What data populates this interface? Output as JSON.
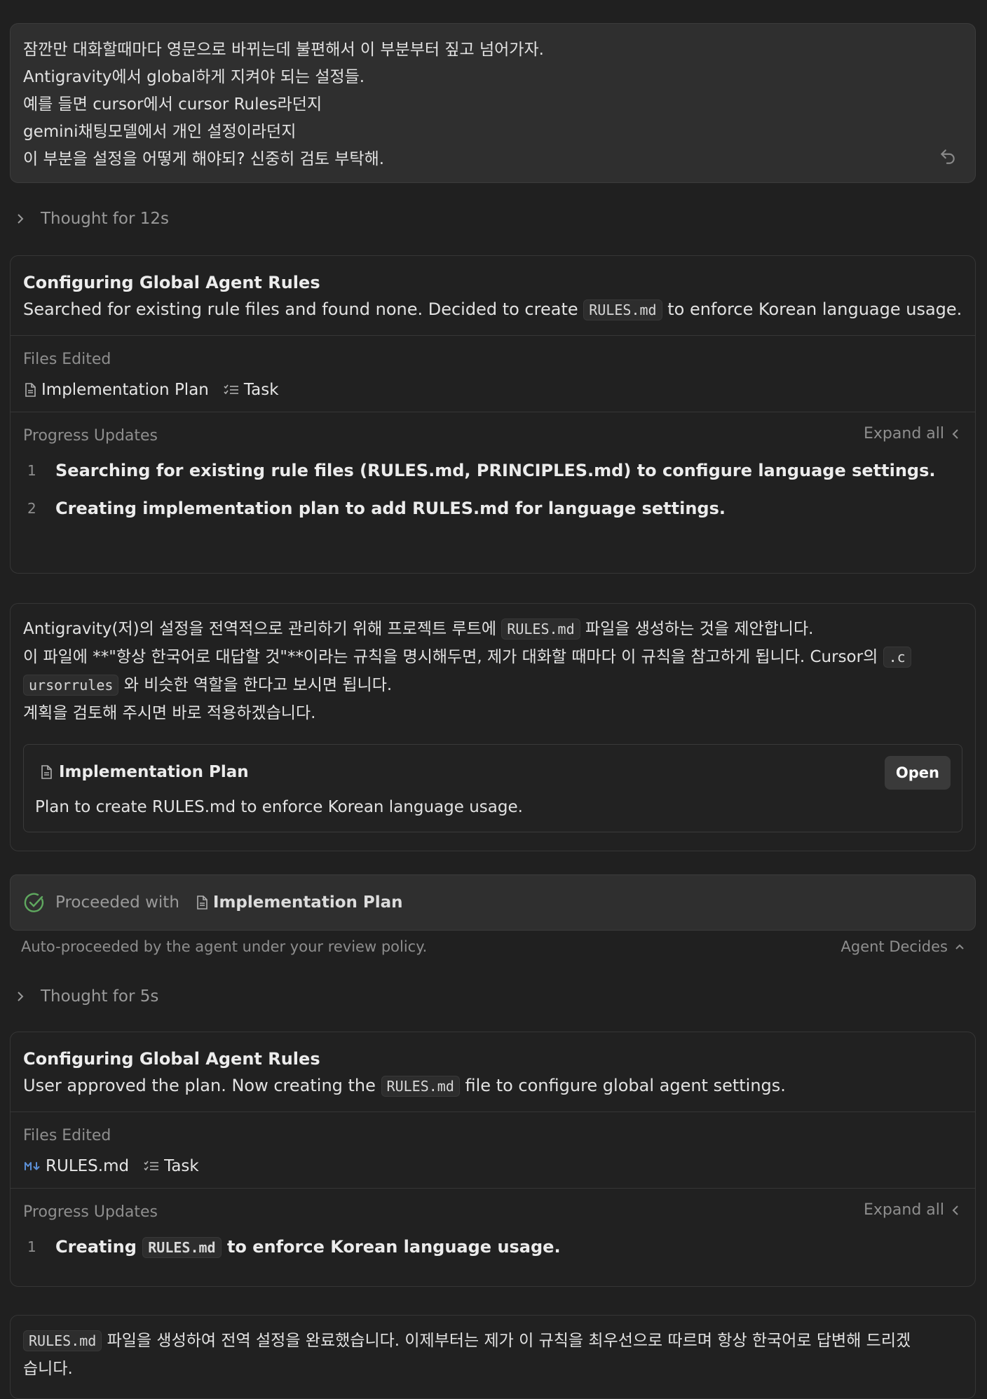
{
  "user_message": {
    "lines": [
      "잠깐만 대화할때마다 영문으로 바뀌는데 불편해서 이 부분부터 짚고 넘어가자.",
      "Antigravity에서 global하게 지켜야 되는 설정들.",
      "예를 들면 cursor에서 cursor Rules라던지",
      "gemini채팅모델에서 개인 설정이라던지",
      "이 부분을 설정을 어떻게 해야되? 신중히 검토 부탁해."
    ]
  },
  "thought1": {
    "label": "Thought for 12s"
  },
  "task1": {
    "title": "Configuring Global Agent Rules",
    "desc_pre": "Searched for existing rule files and found none. Decided to create",
    "desc_code": "RULES.md",
    "desc_post": "to enforce Korean language usage.",
    "files_label": "Files Edited",
    "files": [
      "Implementation Plan",
      "Task"
    ],
    "progress_label": "Progress Updates",
    "expand_all": "Expand all",
    "steps": [
      {
        "num": "1",
        "text": "Searching for existing rule files (RULES.md, PRINCIPLES.md) to configure language settings."
      },
      {
        "num": "2",
        "text": "Creating implementation plan to add RULES.md for language settings."
      }
    ]
  },
  "response1": {
    "p1_pre": "Antigravity(저)의 설정을 전역적으로 관리하기 위해 프로젝트 루트에",
    "p1_code": "RULES.md",
    "p1_post": "파일을 생성하는 것을 제안합니다.",
    "p2_pre": "이 파일에 **\"항상 한국어로 대답할 것\"**이라는 규칙을 명시해두면, 제가 대화할 때마다 이 규칙을 참고하게 됩니다. Cursor의",
    "p2_code_a": ".c",
    "p2_code_b": "ursorrules",
    "p2_post": "와 비슷한 역할을 한다고 보시면 됩니다.",
    "p3": "계획을 검토해 주시면 바로 적용하겠습니다.",
    "plan_title": "Implementation Plan",
    "open_label": "Open",
    "plan_desc": "Plan to create RULES.md to enforce Korean language usage."
  },
  "proceeded": {
    "label": "Proceeded with",
    "chip": "Implementation Plan",
    "policy_text": "Auto-proceeded by the agent under your review policy.",
    "agent_decides": "Agent Decides"
  },
  "thought2": {
    "label": "Thought for 5s"
  },
  "task2": {
    "title": "Configuring Global Agent Rules",
    "desc_pre": "User approved the plan. Now creating the",
    "desc_code": "RULES.md",
    "desc_post": "file to configure global agent settings.",
    "files_label": "Files Edited",
    "files": [
      "RULES.md",
      "Task"
    ],
    "progress_label": "Progress Updates",
    "expand_all": "Expand all",
    "steps": [
      {
        "num": "1",
        "text_pre": "Creating",
        "text_code": "RULES.md",
        "text_post": "to enforce Korean language usage."
      }
    ]
  },
  "final": {
    "code": "RULES.md",
    "line1": "파일을 생성하여 전역 설정을 완료했습니다. 이제부터는 제가 이 규칙을 최우선으로 따르며 항상 한국어로 답변해 드리겠",
    "line2": "습니다."
  },
  "colors": {
    "background": "#202020",
    "user_bubble": "#2f2f2f",
    "check_green": "#5fa85f",
    "markdown_icon_blue": "#5b8fd6"
  }
}
